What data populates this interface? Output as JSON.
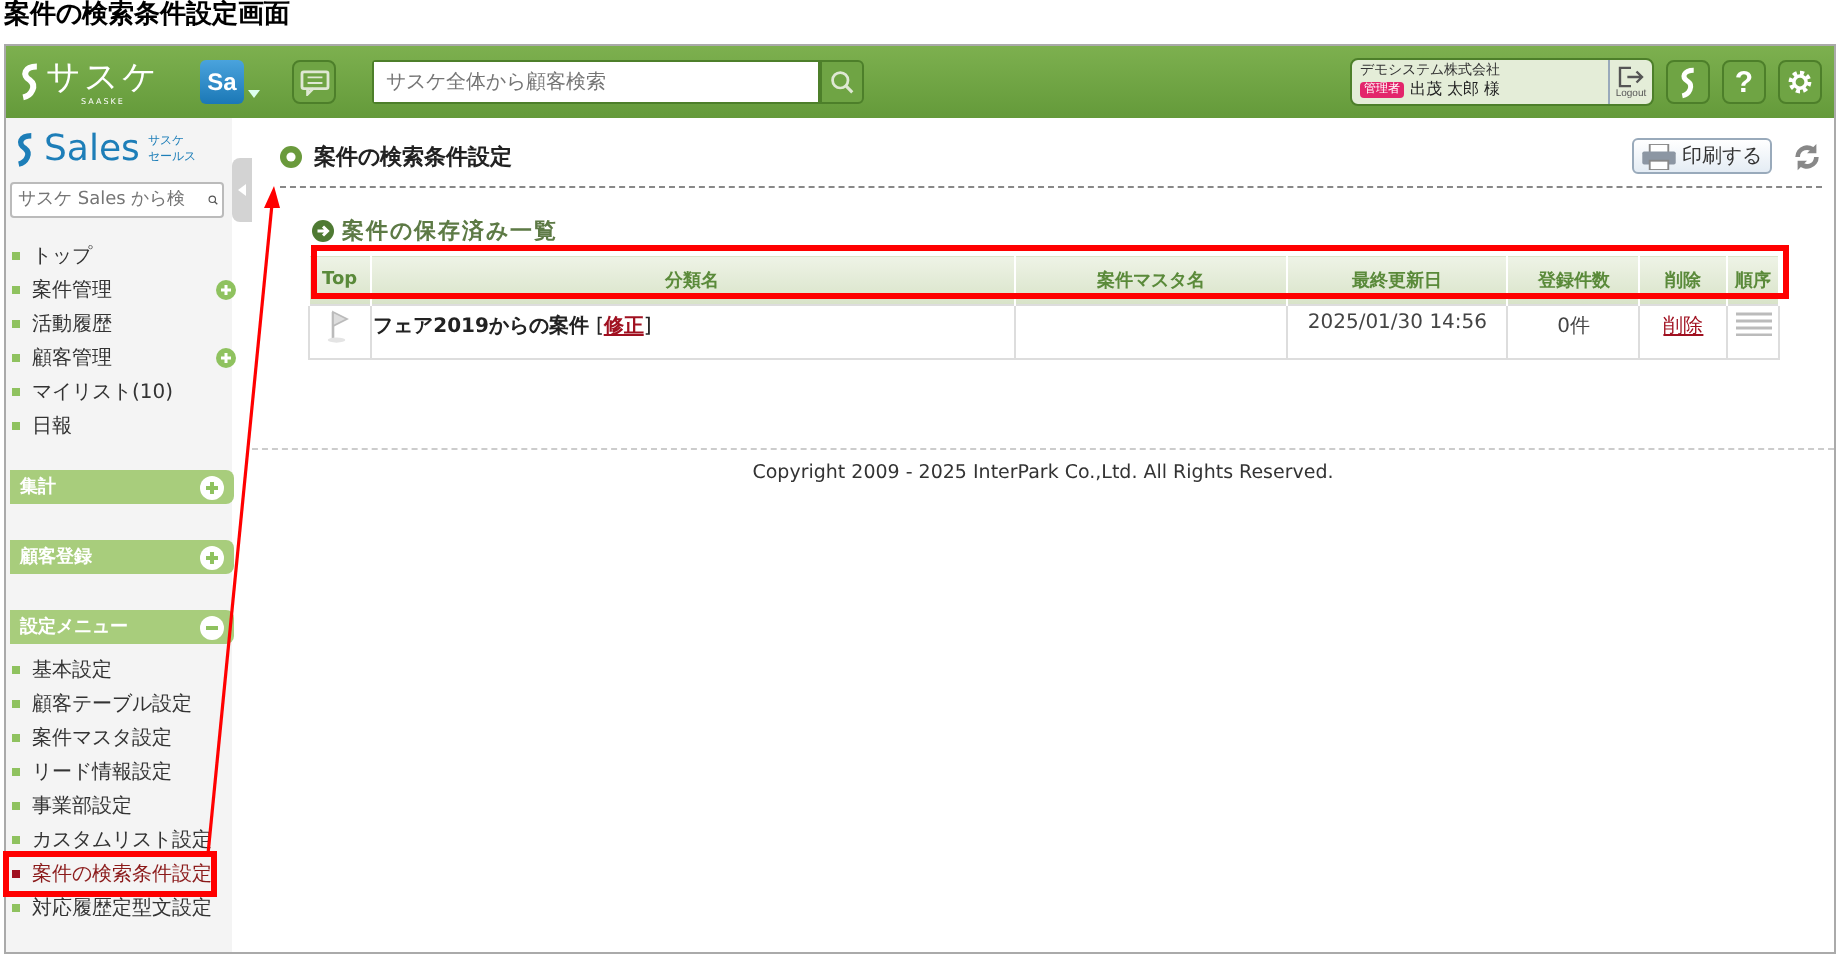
{
  "page_title": "案件の検索条件設定画面",
  "header": {
    "logo": "サスケ",
    "logo_sub": "SAASKE",
    "app_badge": "Sa",
    "search": {
      "placeholder": "サスケ全体から顧客検索"
    },
    "user": {
      "company": "デモシステム株式会社",
      "role": "管理者",
      "name": "出茂 太郎 様"
    },
    "logout": "Logout",
    "help": "?"
  },
  "sidebar": {
    "product": "Sales",
    "product_sub": [
      "サスケ",
      "セールス"
    ],
    "search": {
      "placeholder": "サスケ Sales から検"
    },
    "items": [
      {
        "label": "トップ",
        "has_submenu": false
      },
      {
        "label": "案件管理",
        "has_submenu": true
      },
      {
        "label": "活動履歴",
        "has_submenu": false
      },
      {
        "label": "顧客管理",
        "has_submenu": true
      },
      {
        "label": "マイリスト(10)",
        "has_submenu": false
      },
      {
        "label": "日報",
        "has_submenu": false
      }
    ],
    "sections": [
      {
        "title": "集計",
        "expanded": false
      },
      {
        "title": "顧客登録",
        "expanded": false
      },
      {
        "title": "設定メニュー",
        "expanded": true,
        "items": [
          {
            "label": "基本設定",
            "selected": false
          },
          {
            "label": "顧客テーブル設定",
            "selected": false
          },
          {
            "label": "案件マスタ設定",
            "selected": false
          },
          {
            "label": "リード情報設定",
            "selected": false
          },
          {
            "label": "事業部設定",
            "selected": false
          },
          {
            "label": "カスタムリスト設定",
            "selected": false
          },
          {
            "label": "案件の検索条件設定",
            "selected": true
          },
          {
            "label": "対応履歴定型文設定",
            "selected": false
          }
        ]
      }
    ]
  },
  "main": {
    "title": "案件の検索条件設定",
    "print_button": "印刷する",
    "list_title": "案件の保存済み一覧",
    "table": {
      "columns": [
        "Top",
        "分類名",
        "案件マスタ名",
        "最終更新日",
        "登録件数",
        "削除",
        "順序"
      ],
      "rows": [
        {
          "name": "フェア2019からの案件",
          "edit_open": "[",
          "edit_link": "修正",
          "edit_close": "]",
          "updated": "2025/01/30 14:56",
          "count": "0件",
          "delete_link": "削除"
        }
      ]
    }
  },
  "footer": "Copyright 2009 - 2025 InterPark Co.,Ltd. All Rights Reserved."
}
